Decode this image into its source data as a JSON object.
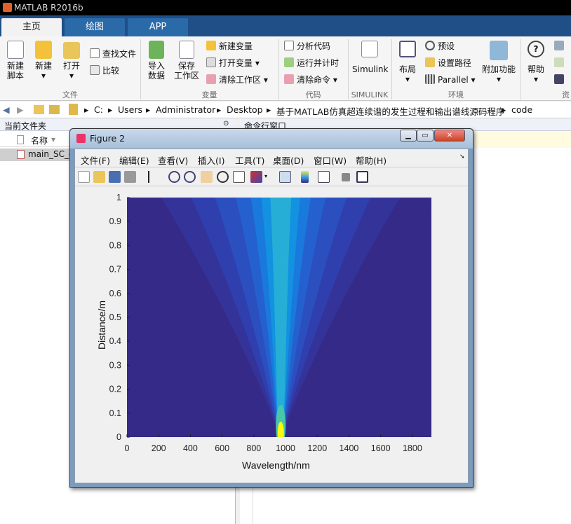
{
  "app": {
    "title": "MATLAB R2016b"
  },
  "tabs": [
    "主页",
    "绘图",
    "APP"
  ],
  "ribbon": {
    "new_script": [
      "新建",
      "脚本"
    ],
    "new": "新建",
    "open": "打开",
    "find_files": "查找文件",
    "compare": "比较",
    "import_data": [
      "导入",
      "数据"
    ],
    "save_workspace": [
      "保存",
      "工作区"
    ],
    "new_variable": "新建变量",
    "open_variable": "打开变量",
    "clear_workspace": "清除工作区",
    "analyze_code": "分析代码",
    "run_and_time": "运行并计时",
    "clear_commands": "清除命令",
    "simulink": "Simulink",
    "layout": "布局",
    "preferences": "预设",
    "set_path": "设置路径",
    "parallel": "Parallel",
    "addons": "附加功能",
    "help": "帮助",
    "groups": [
      "文件",
      "变量",
      "代码",
      "SIMULINK",
      "环境",
      "资"
    ]
  },
  "address": {
    "crumbs": [
      "C:",
      "Users",
      "Administrator",
      "Desktop",
      "基于MATLAB仿真超连续谱的发生过程和输出谱线源码程序",
      "code"
    ]
  },
  "left_pane": {
    "title": "当前文件夹",
    "column_name": "名称",
    "file": "main_SC_c"
  },
  "cmd_pane": {
    "title": "命令行窗口"
  },
  "figure": {
    "title": "Figure 2",
    "menus": [
      "文件(F)",
      "编辑(E)",
      "查看(V)",
      "插入(I)",
      "工具(T)",
      "桌面(D)",
      "窗口(W)",
      "帮助(H)"
    ]
  },
  "chart_data": {
    "type": "heatmap",
    "title": "",
    "xlabel": "Wavelength/nm",
    "ylabel": "Distance/m",
    "xlim": [
      0,
      1920
    ],
    "ylim": [
      0,
      1
    ],
    "xticks": [
      0,
      200,
      400,
      600,
      800,
      1000,
      1200,
      1400,
      1600,
      1800
    ],
    "yticks": [
      0,
      0.1,
      0.2,
      0.3,
      0.4,
      0.5,
      0.6,
      0.7,
      0.8,
      0.9,
      1
    ],
    "peak_center_nm": 970,
    "colors": {
      "low": "#352a87",
      "mid": "#0f6fd8",
      "high": "#f9fb0e"
    }
  }
}
